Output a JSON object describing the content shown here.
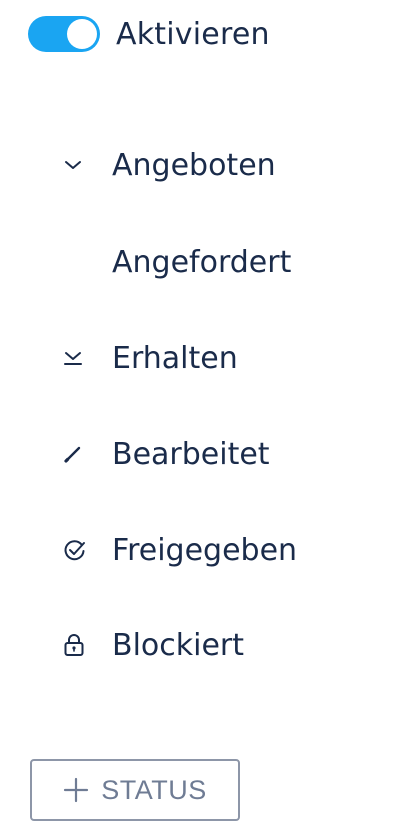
{
  "toggle": {
    "label": "Aktivieren",
    "state": "on",
    "accent_color": "#1aa5f2"
  },
  "statuses": [
    {
      "label": "Angeboten",
      "icon": "chevron-down-icon"
    },
    {
      "label": "Angefordert",
      "icon": ""
    },
    {
      "label": "Erhalten",
      "icon": "download-icon"
    },
    {
      "label": "Bearbeitet",
      "icon": "pencil-icon"
    },
    {
      "label": "Freigegeben",
      "icon": "check-circle-icon"
    },
    {
      "label": "Blockiert",
      "icon": "lock-icon"
    }
  ],
  "add_button": {
    "label": "STATUS",
    "icon": "plus-icon"
  },
  "colors": {
    "text": "#1a2b4a",
    "button_border": "#8d96a8",
    "button_text": "#6f7c94"
  }
}
